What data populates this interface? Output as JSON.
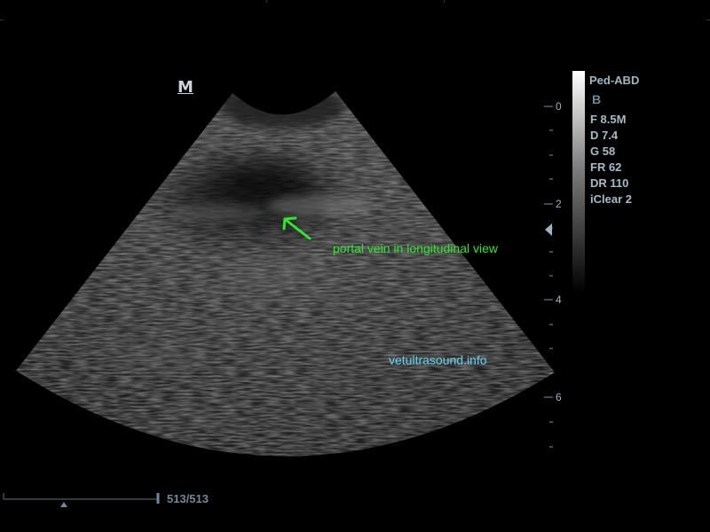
{
  "image": {
    "orientation_marker": "M",
    "preset": "Ped-ABD",
    "mode": "B",
    "parameters": [
      "F 8.5M",
      "D 7.4",
      "G 58",
      "FR 62",
      "DR 110",
      "iClear 2"
    ],
    "depth_labels": [
      "0",
      "2",
      "4",
      "6"
    ],
    "annotation": "portal vein in longitudinal view",
    "watermark": "vetultrasound.info",
    "cine_counter": "513/513",
    "colors": {
      "annotation": "#2ee62e",
      "watermark": "#5fd4f0",
      "overlay_text": "#a9bac6"
    }
  }
}
